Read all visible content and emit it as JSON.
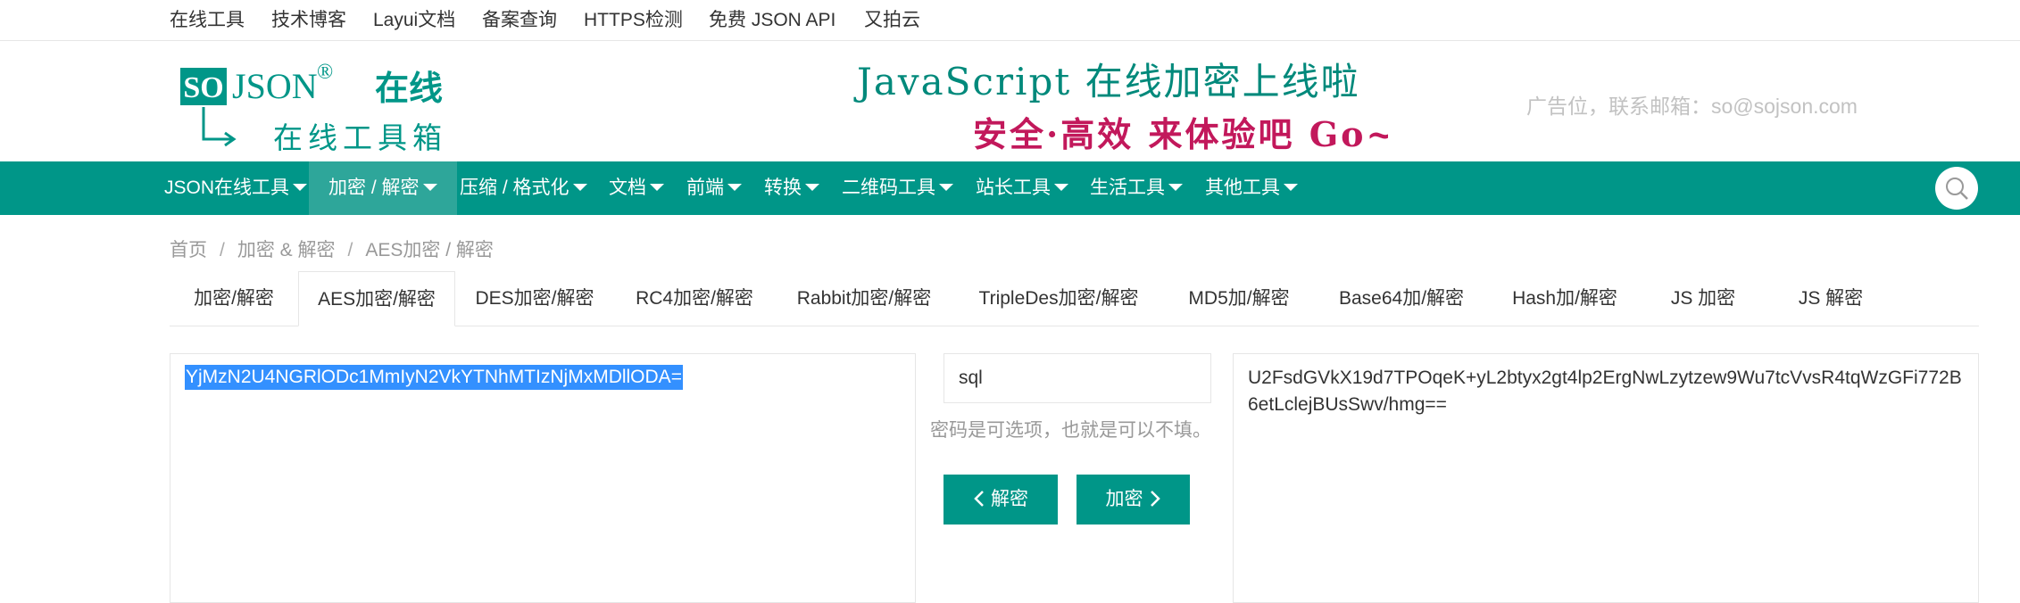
{
  "topbar": {
    "links": [
      "在线工具",
      "技术博客",
      "Layui文档",
      "备案查询",
      "HTTPS检测",
      "免费 JSON API",
      "又拍云"
    ]
  },
  "header": {
    "logo": {
      "so": "SO",
      "json": "JSON",
      "reg": "®",
      "zaixian": "在线",
      "sub": "在线工具箱"
    },
    "banner": {
      "line1": "JavaScript 在线加密上线啦",
      "line2": "安全·高效 来体验吧 Go~"
    },
    "ad": "广告位，联系邮箱：so@sojson.com"
  },
  "nav": {
    "items": [
      "JSON在线工具",
      "加密 / 解密",
      "压缩 / 格式化",
      "文档",
      "前端",
      "转换",
      "二维码工具",
      "站长工具",
      "生活工具",
      "其他工具"
    ],
    "active_index": 1
  },
  "breadcrumb": [
    "首页",
    "加密 & 解密",
    "AES加密 / 解密"
  ],
  "tabs": {
    "items": [
      "加密/解密",
      "AES加密/解密",
      "DES加密/解密",
      "RC4加密/解密",
      "Rabbit加密/解密",
      "TripleDes加密/解密",
      "MD5加/解密",
      "Base64加/解密",
      "Hash加/解密",
      "JS 加密",
      "JS 解密"
    ],
    "active_index": 1
  },
  "tool": {
    "input_value": "YjMzN2U4NGRlODc1MmIyN2VkYTNhMTIzNjMxMDllODA=",
    "password_value": "sql",
    "password_hint": "密码是可选项，也就是可以不填。",
    "decrypt_label": "解密",
    "encrypt_label": "加密",
    "output_value": "U2FsdGVkX19d7TPOqeK+yL2btyx2gt4lp2ErgNwLzytzew9Wu7tcVvsR4tqWzGFi772B6etLclejBUsSwv/hmg=="
  },
  "colors": {
    "primary": "#009688",
    "selection": "#3390ff",
    "banner_green": "#00897b",
    "banner_red": "#c2185b"
  }
}
